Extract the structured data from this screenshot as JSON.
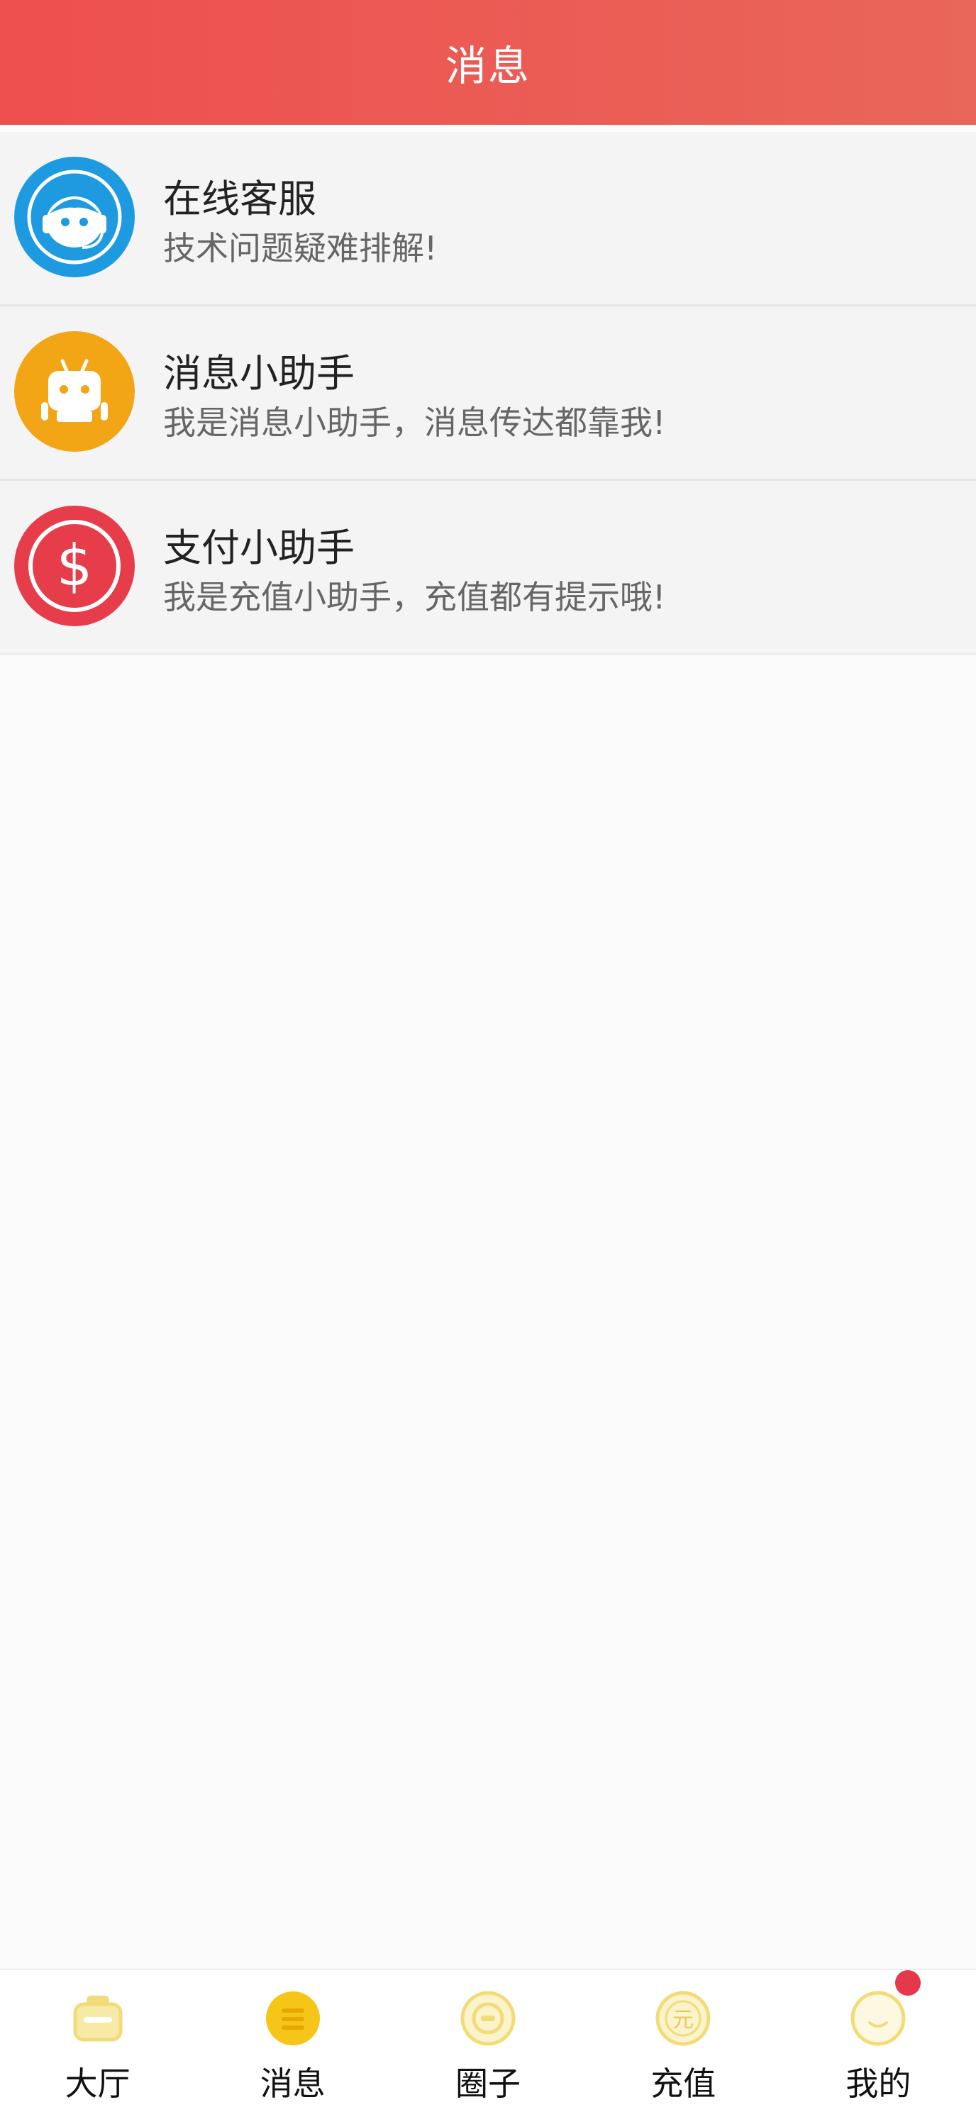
{
  "header": {
    "title": "消息"
  },
  "messages": [
    {
      "title": "在线客服",
      "subtitle": "技术问题疑难排解!",
      "icon": "customer-service-icon",
      "color": "#1e9be0"
    },
    {
      "title": "消息小助手",
      "subtitle": "我是消息小助手，消息传达都靠我!",
      "icon": "robot-icon",
      "color": "#f2a515"
    },
    {
      "title": "支付小助手",
      "subtitle": "我是充值小助手，充值都有提示哦!",
      "icon": "dollar-icon",
      "color": "#e73c4a"
    }
  ],
  "tabs": [
    {
      "label": "大厅",
      "icon": "lobby-icon",
      "active": false
    },
    {
      "label": "消息",
      "icon": "message-icon",
      "active": true
    },
    {
      "label": "圈子",
      "icon": "circle-icon",
      "active": false
    },
    {
      "label": "充值",
      "icon": "recharge-icon",
      "active": false
    },
    {
      "label": "我的",
      "icon": "profile-icon",
      "active": false,
      "badge": true
    }
  ],
  "colors": {
    "header_start": "#ee4f4f",
    "header_end": "#e9665a",
    "tab_icon": "#f2dc78",
    "tab_icon_active": "#f5c518",
    "badge": "#e5384a"
  }
}
